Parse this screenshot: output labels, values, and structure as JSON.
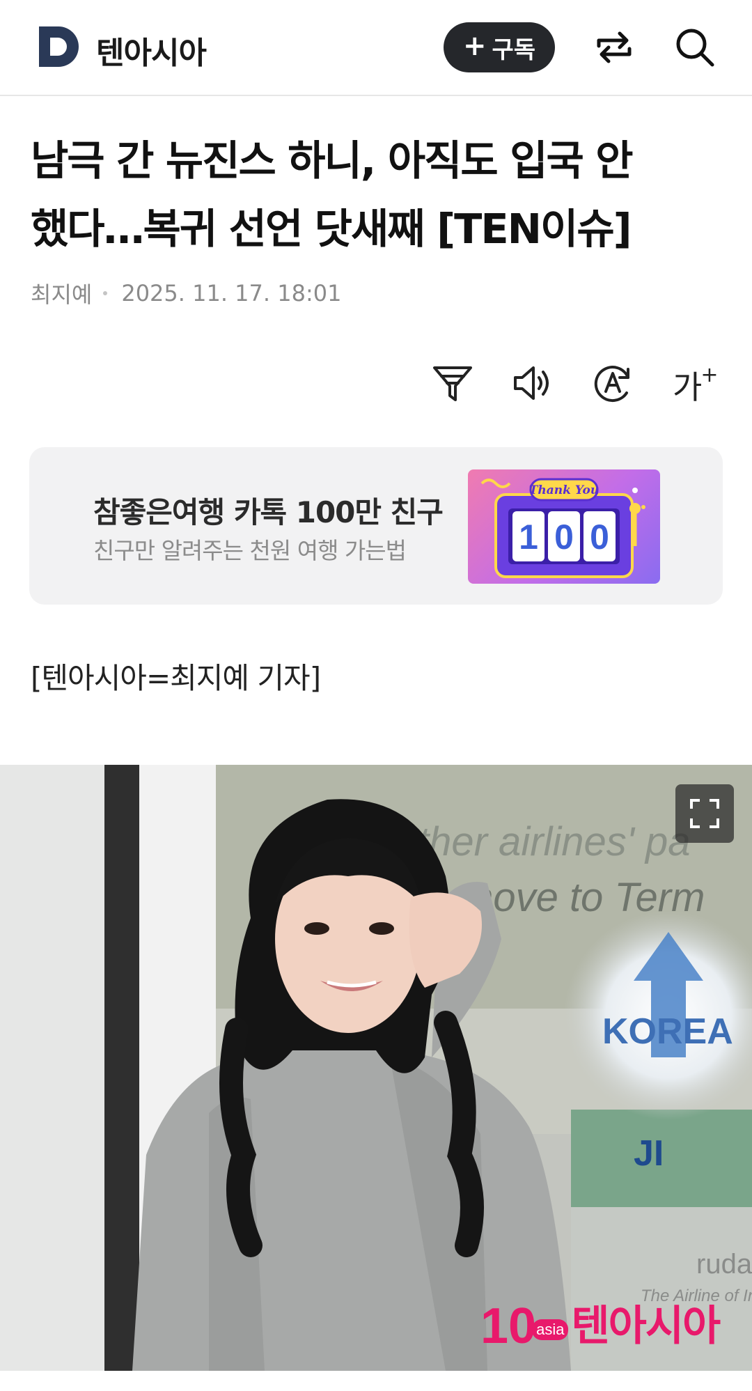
{
  "header": {
    "brand": "텐아시아",
    "subscribe_label": "구독",
    "subscribe_plus": "+",
    "icons": {
      "logo": "d-logo-icon",
      "share": "share-icon",
      "search": "search-icon"
    }
  },
  "article": {
    "title_line1": "남극 간 뉴진스 하니, 아직도 입국 안",
    "title_line2": "했다…복귀 선언 닷새째 [TEN이슈]",
    "author": "최지예",
    "datetime": "2025. 11. 17. 18:01",
    "byline": "[텐아시아=최지예 기자]"
  },
  "tools": {
    "icons": [
      "filter-icon",
      "speaker-icon",
      "translate-icon"
    ],
    "font_size_label": "가",
    "font_size_plus": "+"
  },
  "banner": {
    "title": "참좋은여행 카톡 100만 친구",
    "subtitle": "친구만 알려주는 천원 여행 가는법",
    "image_text_top": "Thank You",
    "image_number": "100"
  },
  "photo": {
    "sign_line1": "ther airlines' pa",
    "sign_line2": "move to Term",
    "sign_korea": "KOREA",
    "sign_jin": "JI",
    "sign_garuda": "ruda Indo",
    "sign_garuda_sub": "The Airline of In",
    "watermark_num": "10",
    "watermark_asia": "asia",
    "watermark_name": "텐아시아"
  },
  "colors": {
    "subscribe_bg": "#25272b",
    "banner_bg": "#f2f2f3",
    "watermark": "#e8196b",
    "logo": "#2a3957"
  }
}
